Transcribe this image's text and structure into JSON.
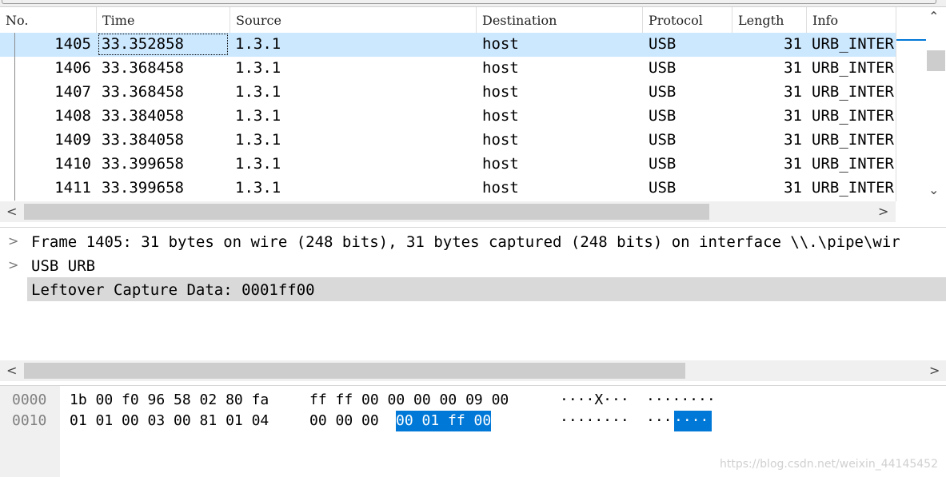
{
  "columns": [
    "No.",
    "Time",
    "Source",
    "Destination",
    "Protocol",
    "Length",
    "Info"
  ],
  "packets": [
    {
      "no": "1405",
      "time": "33.352858",
      "source": "1.3.1",
      "dest": "host",
      "proto": "USB",
      "len": "31",
      "info": "URB_INTER"
    },
    {
      "no": "1406",
      "time": "33.368458",
      "source": "1.3.1",
      "dest": "host",
      "proto": "USB",
      "len": "31",
      "info": "URB_INTER"
    },
    {
      "no": "1407",
      "time": "33.368458",
      "source": "1.3.1",
      "dest": "host",
      "proto": "USB",
      "len": "31",
      "info": "URB_INTER"
    },
    {
      "no": "1408",
      "time": "33.384058",
      "source": "1.3.1",
      "dest": "host",
      "proto": "USB",
      "len": "31",
      "info": "URB_INTER"
    },
    {
      "no": "1409",
      "time": "33.384058",
      "source": "1.3.1",
      "dest": "host",
      "proto": "USB",
      "len": "31",
      "info": "URB_INTER"
    },
    {
      "no": "1410",
      "time": "33.399658",
      "source": "1.3.1",
      "dest": "host",
      "proto": "USB",
      "len": "31",
      "info": "URB_INTER"
    },
    {
      "no": "1411",
      "time": "33.399658",
      "source": "1.3.1",
      "dest": "host",
      "proto": "USB",
      "len": "31",
      "info": "URB_INTER"
    }
  ],
  "selected_packet": "1405",
  "details": [
    {
      "text": "Frame 1405: 31 bytes on wire (248 bits), 31 bytes captured (248 bits) on interface \\\\.\\pipe\\wir",
      "expandable": true
    },
    {
      "text": "USB URB",
      "expandable": true
    },
    {
      "text": "Leftover Capture Data: 0001ff00",
      "expandable": false,
      "highlighted": true
    }
  ],
  "hex": {
    "rows": [
      {
        "offset": "0000",
        "bytes_a": "1b 00 f0 96 58 02 80 fa",
        "bytes_b": "ff ff 00 00 00 00 09 00",
        "bytes_sel": "",
        "ascii_a": "····X···",
        "ascii_b": "········",
        "ascii_sel": ""
      },
      {
        "offset": "0010",
        "bytes_a": "01 01 00 03 00 81 01 04",
        "bytes_b": "00 00 00",
        "bytes_sel": "00 01 ff 00",
        "ascii_a": "········",
        "ascii_b": "···",
        "ascii_sel": "····"
      }
    ]
  },
  "watermark": "https://blog.csdn.net/weixin_44145452",
  "colors": {
    "selection": "#cce8ff",
    "hex_selection": "#0078d7",
    "detail_highlight": "#d9d9d9"
  }
}
